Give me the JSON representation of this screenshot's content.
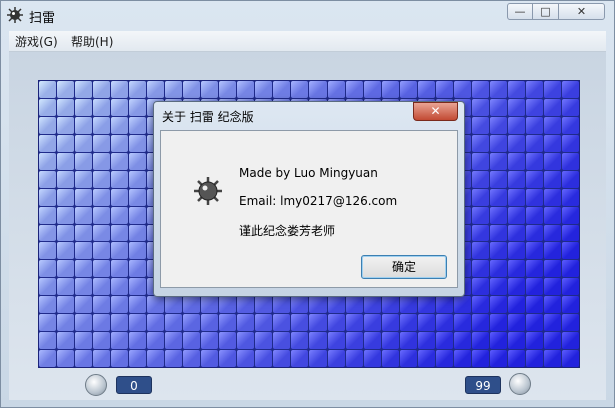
{
  "window": {
    "title": "扫雷",
    "controls": {
      "minimize": "—",
      "maximize": "□",
      "close": "✕"
    }
  },
  "menu": [
    {
      "label": "游戏(G)"
    },
    {
      "label": "帮助(H)"
    }
  ],
  "board": {
    "rows": 16,
    "cols": 30,
    "tile_color_left": "#9ab0e8",
    "tile_color_right": "#2222dd"
  },
  "status": {
    "timer_value": "0",
    "mines_remaining": "99",
    "timer_icon": "clock-icon",
    "mine_icon": "mine-icon"
  },
  "dialog": {
    "title": "关于 扫雷 纪念版",
    "close_label": "✕",
    "line1": "Made by Luo Mingyuan",
    "line2": "Email:  lmy0217@126.com",
    "line3": "谨此纪念娄芳老师",
    "ok_label": "确定",
    "icon": "mine-icon"
  }
}
